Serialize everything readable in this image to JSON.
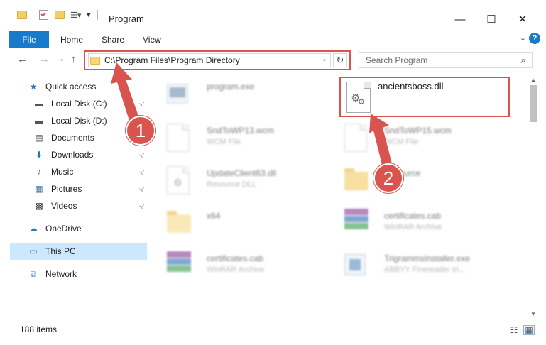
{
  "window": {
    "title": "Program"
  },
  "window_controls": {
    "minimize": "—",
    "maximize": "☐",
    "close": "✕"
  },
  "ribbon": {
    "file_tab": "File",
    "tabs": [
      "Home",
      "Share",
      "View"
    ],
    "expand": "⌄",
    "help": "?"
  },
  "nav": {
    "back": "←",
    "forward": "→",
    "recent": "⌄",
    "up": "↑",
    "address": "C:\\Program Files\\Program Directory",
    "address_dropdown": "⌄",
    "refresh": "↻",
    "search_placeholder": "Search Program",
    "search_icon": "⌕"
  },
  "sidebar": {
    "items": [
      {
        "label": "Quick access",
        "icon": "star-icon",
        "glyph": "★",
        "color": "#2a78c8",
        "pinned": false
      },
      {
        "label": "Local Disk (C:)",
        "icon": "drive-icon",
        "glyph": "▬",
        "color": "#555",
        "pinned": true
      },
      {
        "label": "Local Disk (D:)",
        "icon": "drive-icon",
        "glyph": "▬",
        "color": "#555",
        "pinned": false
      },
      {
        "label": "Documents",
        "icon": "documents-icon",
        "glyph": "▤",
        "color": "#666",
        "pinned": false
      },
      {
        "label": "Downloads",
        "icon": "download-icon",
        "glyph": "⬇",
        "color": "#1979ca",
        "pinned": true
      },
      {
        "label": "Music",
        "icon": "music-icon",
        "glyph": "♪",
        "color": "#1979ca",
        "pinned": true
      },
      {
        "label": "Pictures",
        "icon": "pictures-icon",
        "glyph": "▦",
        "color": "#4a7aa8",
        "pinned": true
      },
      {
        "label": "Videos",
        "icon": "videos-icon",
        "glyph": "▩",
        "color": "#333",
        "pinned": true
      },
      {
        "label": "OneDrive",
        "icon": "cloud-icon",
        "glyph": "☁",
        "color": "#1979ca",
        "pinned": false
      },
      {
        "label": "This PC",
        "icon": "computer-icon",
        "glyph": "▭",
        "color": "#2a78c8",
        "pinned": false,
        "selected": true
      },
      {
        "label": "Network",
        "icon": "network-icon",
        "glyph": "⧉",
        "color": "#2a78c8",
        "pinned": false
      }
    ],
    "pin_glyph": "📌"
  },
  "files": {
    "highlighted": {
      "name": "ancientsboss.dll",
      "icon": "dll-gear-icon"
    },
    "blurred": [
      {
        "name": "program.exe",
        "type": "",
        "icon": "exe-icon"
      },
      {
        "name": "SndToWP13.wcm",
        "type": "WCM File",
        "icon": "document-icon"
      },
      {
        "name": "SndToWP15.wcm",
        "type": "WCM File",
        "icon": "document-icon"
      },
      {
        "name": "UpdateClient63.dll",
        "type": "Resource DLL",
        "icon": "dll-icon"
      },
      {
        "name": "Resource",
        "type": "",
        "icon": "folder-icon"
      },
      {
        "name": "x64",
        "type": "",
        "icon": "folder-icon"
      },
      {
        "name": "certificates.cab",
        "type": "WinRAR Archive",
        "icon": "winrar-icon"
      },
      {
        "name": "certificates.cab",
        "type": "WinRAR Archive",
        "icon": "winrar-icon"
      },
      {
        "name": "TrigrammsInstaller.exe",
        "type": "ABBYY Finereader tri...",
        "icon": "installer-icon"
      }
    ]
  },
  "annotations": {
    "step1": "1",
    "step2": "2",
    "color": "#d9534f"
  },
  "status": {
    "item_count": "188 items"
  },
  "view_buttons": {
    "details": "☷",
    "large_icons": "▦"
  },
  "scrollbar": {
    "up": "▲",
    "down": "▼"
  }
}
